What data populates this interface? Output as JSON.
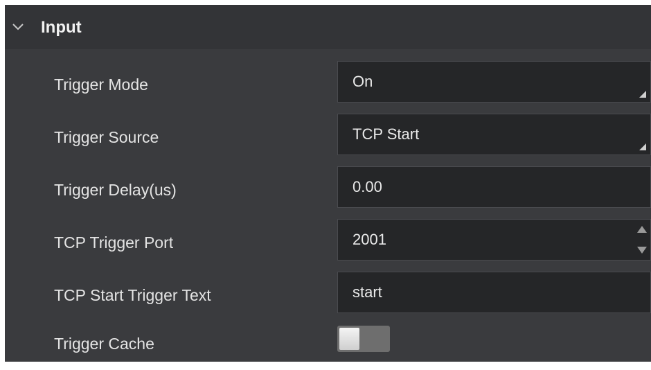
{
  "section": {
    "title": "Input",
    "icon": "chevron-down-icon"
  },
  "rows": [
    {
      "label": "Trigger Mode",
      "value": "On",
      "kind": "dropdown"
    },
    {
      "label": "Trigger Source",
      "value": "TCP Start",
      "kind": "dropdown"
    },
    {
      "label": "Trigger Delay(us)",
      "value": "0.00",
      "kind": "text"
    },
    {
      "label": "TCP Trigger Port",
      "value": "2001",
      "kind": "spinbox"
    },
    {
      "label": "TCP Start Trigger Text",
      "value": "start",
      "kind": "text"
    },
    {
      "label": "Trigger Cache",
      "value": "off",
      "kind": "toggle"
    }
  ],
  "colors": {
    "panel_bg": "#3a3b3e",
    "header_bg": "#333437",
    "field_bg": "#252628",
    "text": "#e4e4e4"
  }
}
